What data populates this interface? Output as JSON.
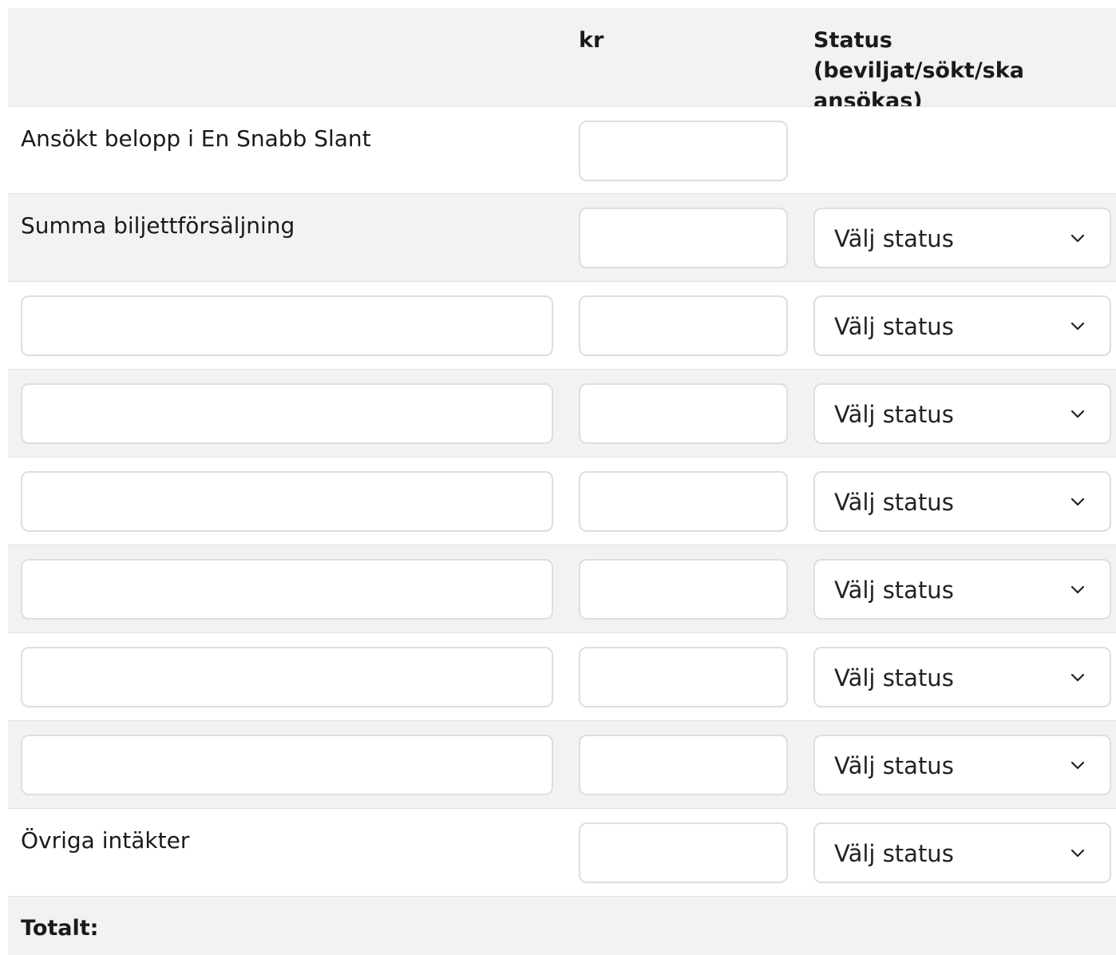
{
  "header": {
    "amount_col": "kr",
    "status_col": "Status (beviljat/sökt/ska ansökas)"
  },
  "rows": [
    {
      "label": "Ansökt belopp i En Snabb Slant",
      "amount": ""
    },
    {
      "label": "Summa biljettförsäljning",
      "amount": "",
      "status": "Välj status"
    },
    {
      "description": "",
      "amount": "",
      "status": "Välj status"
    },
    {
      "description": "",
      "amount": "",
      "status": "Välj status"
    },
    {
      "description": "",
      "amount": "",
      "status": "Välj status"
    },
    {
      "description": "",
      "amount": "",
      "status": "Välj status"
    },
    {
      "description": "",
      "amount": "",
      "status": "Välj status"
    },
    {
      "description": "",
      "amount": "",
      "status": "Välj status"
    },
    {
      "label": "Övriga intäkter",
      "amount": "",
      "status": "Välj status"
    }
  ],
  "total": {
    "label": "Totalt:"
  },
  "icons": {
    "select_arrow": "chevron-down-icon"
  },
  "colors": {
    "row_alt_bg": "#f2f2f2",
    "border": "#dedede",
    "text": "#1a1a1a"
  }
}
